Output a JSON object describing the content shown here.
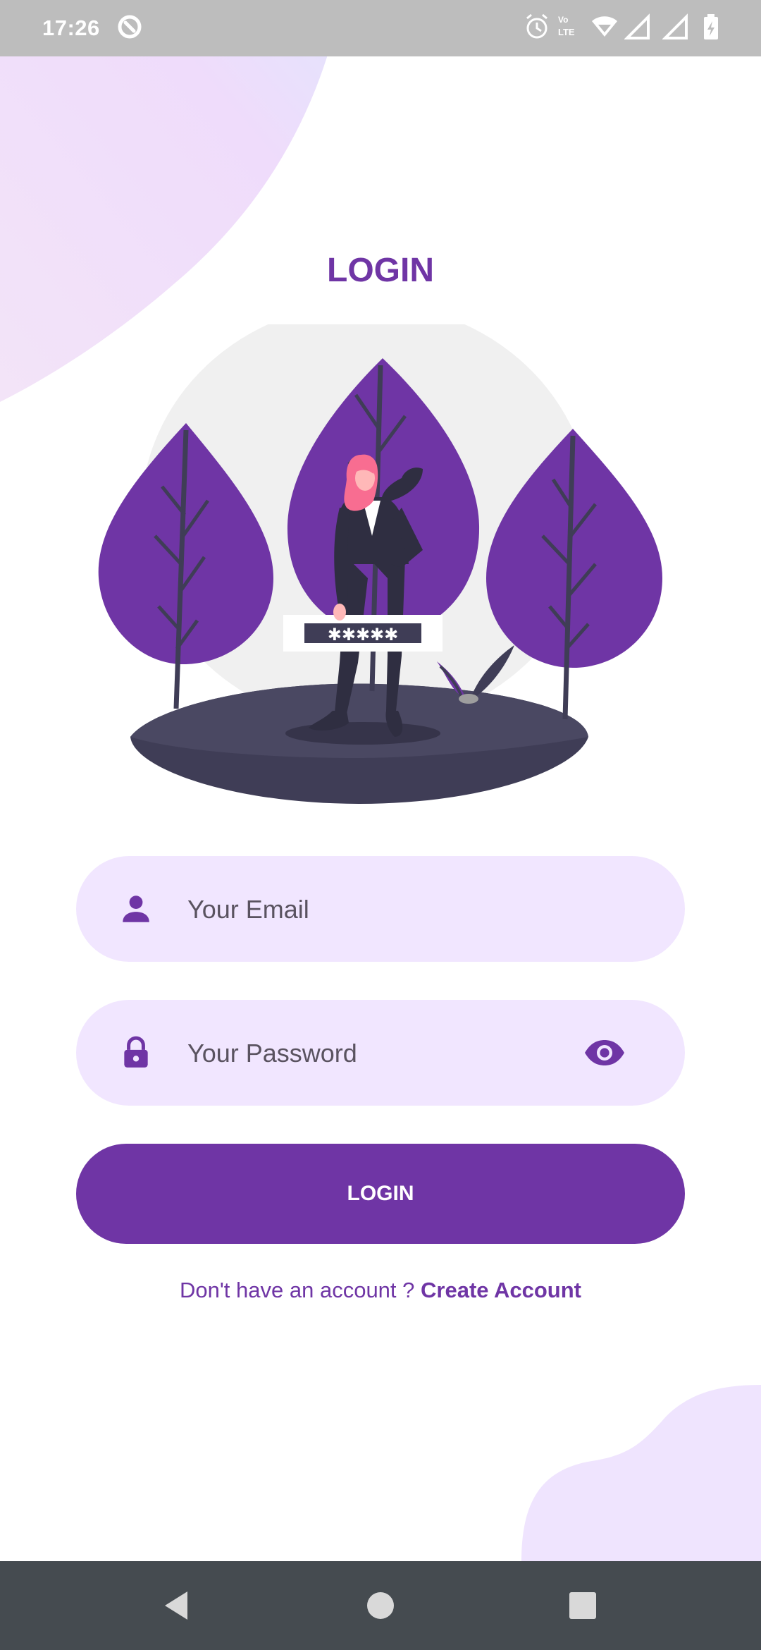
{
  "status_bar": {
    "time": "17:26",
    "icons": [
      "app-notification-icon",
      "alarm-icon",
      "volte-icon",
      "wifi-icon",
      "signal-icon",
      "signal-icon",
      "battery-charging-icon"
    ]
  },
  "page": {
    "title": "LOGIN"
  },
  "illustration": {
    "name": "woman-with-password-illustration",
    "password_mask": "✱✱✱✱✱"
  },
  "form": {
    "email": {
      "placeholder": "Your Email",
      "value": "",
      "icon": "person-icon"
    },
    "password": {
      "placeholder": "Your Password",
      "value": "",
      "icon": "lock-icon",
      "toggle_icon": "eye-icon"
    },
    "login_label": "LOGIN"
  },
  "signup": {
    "prompt": "Don't have an account ?",
    "link_label": "Create Account"
  },
  "nav_bar": {
    "icons": [
      "back-icon",
      "home-icon",
      "recents-icon"
    ]
  },
  "colors": {
    "primary": "#6f35a5",
    "primary_light": "#f1e6ff",
    "status_bar": "#bdbdbd",
    "nav_bar": "#454b50",
    "ground": "#3f3d56"
  }
}
